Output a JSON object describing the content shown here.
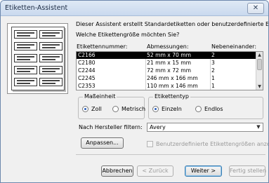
{
  "window": {
    "title": "Etiketten-Assistent",
    "close_glyph": "✕"
  },
  "intro": "Dieser Assistent erstellt Standardetiketten oder benutzerdefinierte Etiketten.",
  "question": "Welche Etikettengröße möchten Sie?",
  "columns": {
    "number": "Etikettennummer:",
    "size": "Abmessungen:",
    "across": "Nebeneinander:"
  },
  "labels": [
    {
      "number": "C2166",
      "size": "52 mm x 70 mm",
      "across": "2",
      "selected": true
    },
    {
      "number": "C2180",
      "size": "21 mm x 15 mm",
      "across": "3",
      "selected": false
    },
    {
      "number": "C2244",
      "size": "72 mm x 72 mm",
      "across": "2",
      "selected": false
    },
    {
      "number": "C2245",
      "size": "246 mm x 166 mm",
      "across": "1",
      "selected": false
    },
    {
      "number": "C2353",
      "size": "110 mm x 146 mm",
      "across": "1",
      "selected": false
    }
  ],
  "units_group": {
    "title": "Maßeinheit",
    "options": [
      "Zoll",
      "Metrisch"
    ],
    "selected": "Zoll"
  },
  "type_group": {
    "title": "Etikettentyp",
    "options": [
      "Einzeln",
      "Endlos"
    ],
    "selected": "Einzeln"
  },
  "filter": {
    "label": "Nach Hersteller filtern:",
    "value": "Avery"
  },
  "customize_button": "Anpassen...",
  "custom_sizes_checkbox": {
    "label": "Benutzerdefinierte Etikettengrößen anzeigen",
    "checked": false,
    "enabled": false
  },
  "buttons": {
    "cancel": "Abbrechen",
    "back": "< Zurück",
    "next": "Weiter >",
    "finish": "Fertig stellen"
  },
  "icons": {
    "scroll_up": "scroll-up-icon",
    "scroll_down": "scroll-down-icon",
    "dropdown": "chevron-down-icon",
    "preview": "label-sheet-icon"
  },
  "colors": {
    "selection": "#000000",
    "titlebar": "#dfe9f5",
    "radio_dot": "#2a5fbd"
  }
}
